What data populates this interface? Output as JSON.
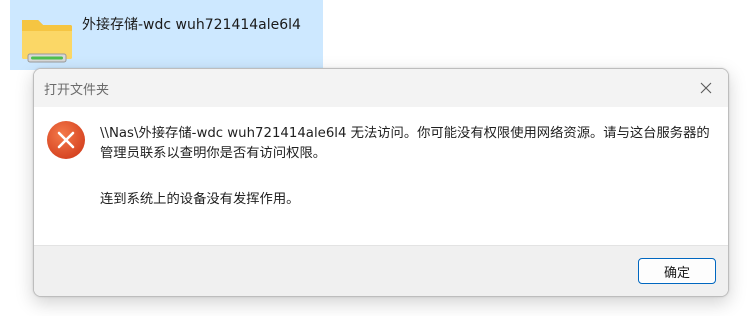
{
  "background": {
    "folder_name": "外接存储-wdc wuh721414ale6l4",
    "folder_icon": "folder-with-network-drive-icon"
  },
  "dialog": {
    "title": "打开文件夹",
    "close_icon": "close-icon",
    "error_icon": "error-icon",
    "message": "\\\\Nas\\外接存储-wdc wuh721414ale6l4 无法访问。你可能没有权限使用网络资源。请与这台服务器的管理员联系以查明你是否有访问权限。",
    "detail": "连到系统上的设备没有发挥作用。",
    "ok_label": "确定"
  },
  "colors": {
    "selection": "#cde8ff",
    "accent": "#0067c0",
    "error": "#e0502c"
  }
}
